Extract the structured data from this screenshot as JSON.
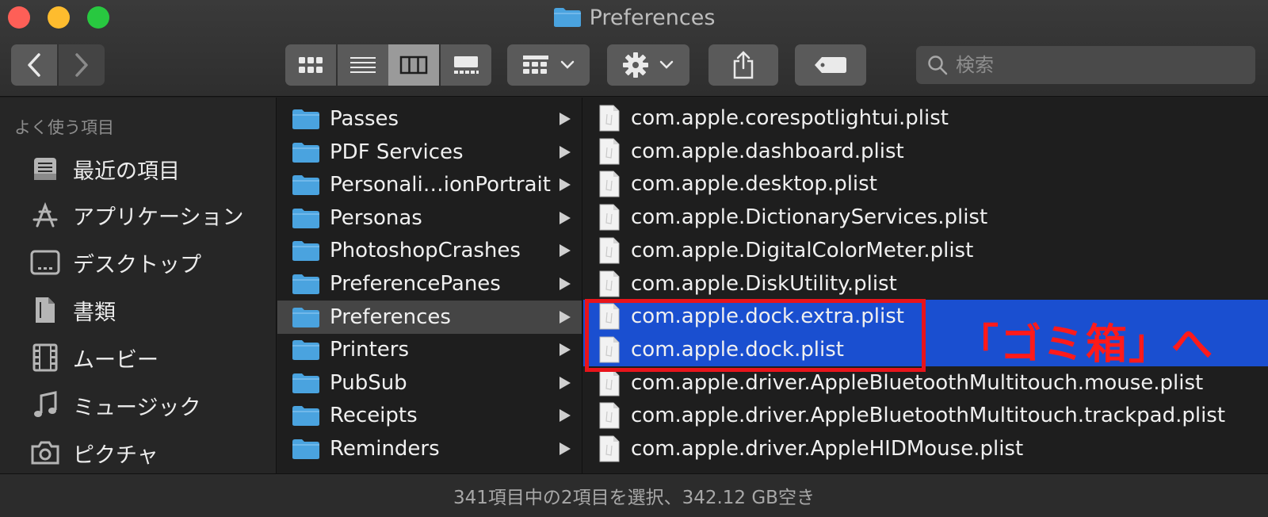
{
  "window": {
    "title": "Preferences"
  },
  "toolbar": {
    "back_icon": "chevron-left",
    "forward_icon": "chevron-right",
    "views": [
      "icon-view",
      "list-view",
      "column-view",
      "gallery-view"
    ],
    "active_view": "column-view",
    "search_placeholder": "検索"
  },
  "sidebar": {
    "heading": "よく使う項目",
    "items": [
      {
        "label": "最近の項目",
        "icon": "recents-icon"
      },
      {
        "label": "アプリケーション",
        "icon": "applications-icon"
      },
      {
        "label": "デスクトップ",
        "icon": "desktop-icon"
      },
      {
        "label": "書類",
        "icon": "documents-icon"
      },
      {
        "label": "ムービー",
        "icon": "movies-icon"
      },
      {
        "label": "ミュージック",
        "icon": "music-icon"
      },
      {
        "label": "ピクチャ",
        "icon": "pictures-icon"
      }
    ]
  },
  "folders": [
    {
      "label": "Passes"
    },
    {
      "label": "PDF Services"
    },
    {
      "label": "Personali…ionPortrait"
    },
    {
      "label": "Personas"
    },
    {
      "label": "PhotoshopCrashes"
    },
    {
      "label": "PreferencePanes"
    },
    {
      "label": "Preferences",
      "selected": true
    },
    {
      "label": "Printers"
    },
    {
      "label": "PubSub"
    },
    {
      "label": "Receipts"
    },
    {
      "label": "Reminders"
    }
  ],
  "files": [
    {
      "label": "com.apple.corespotlightui.plist"
    },
    {
      "label": "com.apple.dashboard.plist"
    },
    {
      "label": "com.apple.desktop.plist"
    },
    {
      "label": "com.apple.DictionaryServices.plist"
    },
    {
      "label": "com.apple.DigitalColorMeter.plist"
    },
    {
      "label": "com.apple.DiskUtility.plist"
    },
    {
      "label": "com.apple.dock.extra.plist",
      "selected": true
    },
    {
      "label": "com.apple.dock.plist",
      "selected": true
    },
    {
      "label": "com.apple.driver.AppleBluetoothMultitouch.mouse.plist"
    },
    {
      "label": "com.apple.driver.AppleBluetoothMultitouch.trackpad.plist"
    },
    {
      "label": "com.apple.driver.AppleHIDMouse.plist"
    }
  ],
  "annotation": {
    "text": "「ゴミ箱」へ",
    "color": "#e8141b"
  },
  "statusbar": {
    "text": "341項目中の2項目を選択、342.12 GB空き"
  },
  "colors": {
    "selection": "#1a4fd0",
    "folder": "#4aa3df"
  }
}
